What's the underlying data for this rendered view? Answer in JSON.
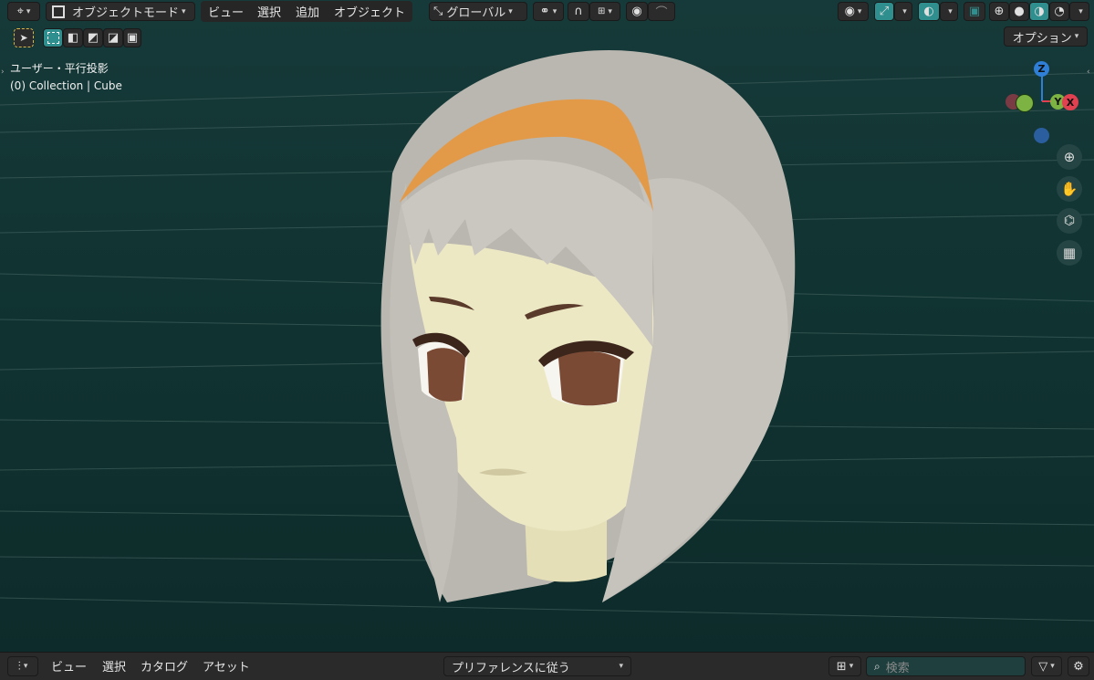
{
  "header": {
    "mode_label": "オブジェクトモード",
    "menus": [
      "ビュー",
      "選択",
      "追加",
      "オブジェクト"
    ],
    "transform_orientation": "グローバル"
  },
  "toolbar": {
    "options_label": "オプション"
  },
  "overlay": {
    "view_name": "ユーザー・平行投影",
    "collection_info": "(0) Collection | Cube"
  },
  "gizmo": {
    "z": "Z",
    "y": "Y",
    "x": "X",
    "colors": {
      "x": "#e0404f",
      "y": "#7cb342",
      "z": "#2f7fd6"
    }
  },
  "asset_browser": {
    "menus": [
      "ビュー",
      "選択",
      "カタログ",
      "アセット"
    ],
    "import_method": "プリファレンスに従う",
    "search_placeholder": "検索"
  },
  "colors": {
    "accent": "#2f8f8f",
    "viewport_bg": "#123836",
    "hair": "#c2beb8",
    "headband": "#e39a48",
    "skin": "#ece8c4"
  }
}
